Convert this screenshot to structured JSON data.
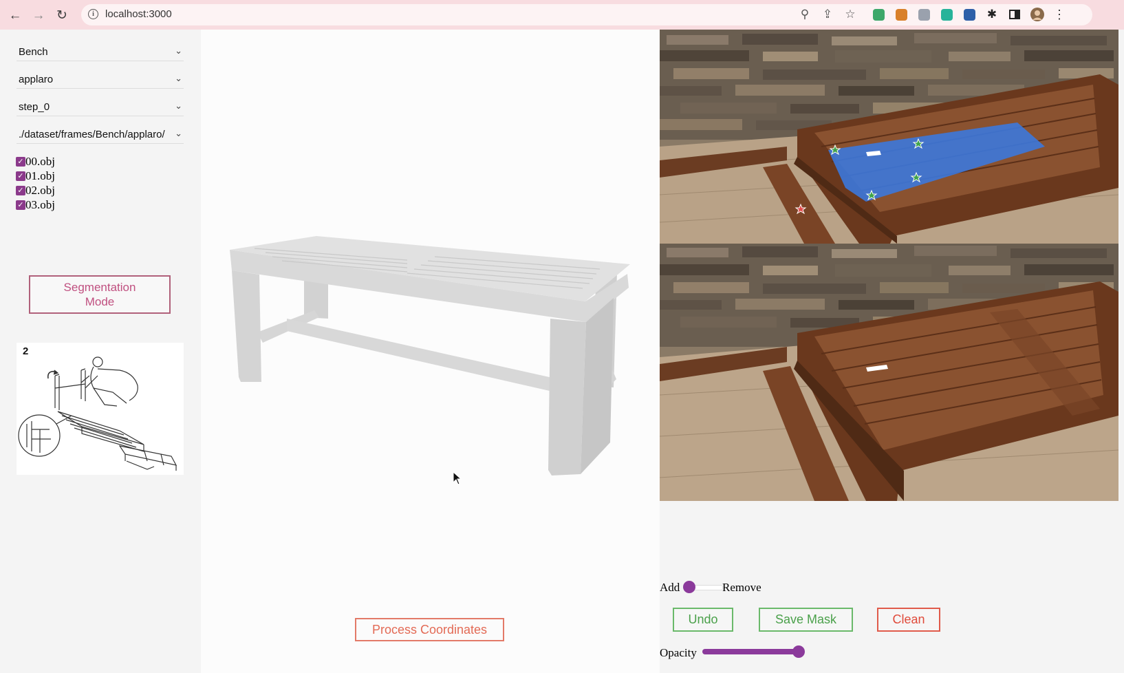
{
  "browser": {
    "url": "localhost:3000",
    "icons": [
      "back-icon",
      "forward-icon",
      "reload-icon",
      "info-icon",
      "zoom-icon",
      "share-icon",
      "bookmark-star-icon",
      "extension-icons",
      "puzzle-icon",
      "sidebar-icon",
      "profile-avatar",
      "menu-icon"
    ]
  },
  "left_panel": {
    "category_select": "Bench",
    "model_select": "applaro",
    "step_select": "step_0",
    "frames_select": "./dataset/frames/Bench/applaro/",
    "objects": [
      {
        "label": "00.obj",
        "checked": true
      },
      {
        "label": "01.obj",
        "checked": true
      },
      {
        "label": "02.obj",
        "checked": true
      },
      {
        "label": "03.obj",
        "checked": true
      }
    ],
    "segmentation_button": "Segmentation Mode",
    "manual_step_number": "2"
  },
  "viewer": {
    "process_button": "Process Coordinates",
    "model_color": "#dcdcdc"
  },
  "right_panel": {
    "mode_add_label": "Add",
    "mode_remove_label": "Remove",
    "mode_value": "Add",
    "undo_button": "Undo",
    "save_mask_button": "Save Mask",
    "clean_button": "Clean",
    "opacity_label": "Opacity",
    "opacity_value": 1.0,
    "mask_color": "#3c78dc"
  },
  "colors": {
    "accent_purple": "#8b3a9b",
    "green_button": "#4aa04a",
    "red_button": "#e04a3a",
    "orange_button": "#e36a55",
    "pink_button": "#c05080"
  }
}
